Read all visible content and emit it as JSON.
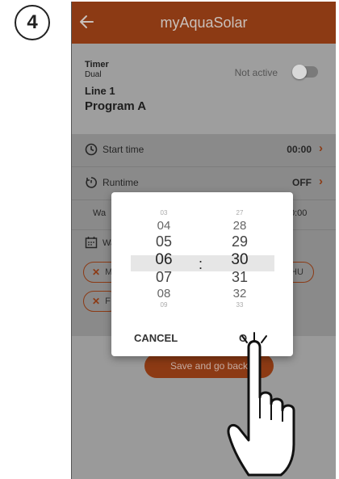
{
  "step": "4",
  "appbar": {
    "title": "myAquaSolar"
  },
  "info": {
    "timer_label": "Timer",
    "timer_value": "Dual",
    "line": "Line 1",
    "program": "Program A",
    "status": "Not active"
  },
  "rows": {
    "start_time_label": "Start time",
    "start_time_value": "00:00",
    "runtime_label": "Runtime",
    "runtime_value": "OFF",
    "wait_label": "Wa",
    "wait_value": "0:00",
    "days_label": "Wa"
  },
  "chips": [
    "M",
    "HU",
    "F"
  ],
  "save_button": "Save and go back",
  "picker": {
    "hours": [
      "03",
      "04",
      "05",
      "06",
      "07",
      "08",
      "09"
    ],
    "minutes": [
      "27",
      "28",
      "29",
      "30",
      "31",
      "32",
      "33"
    ],
    "separator": ":",
    "cancel": "CANCEL",
    "ok": "O"
  },
  "colors": {
    "brand": "#8c3a14",
    "overlay": "#9a9a9a",
    "dialog": "#ffffff"
  }
}
